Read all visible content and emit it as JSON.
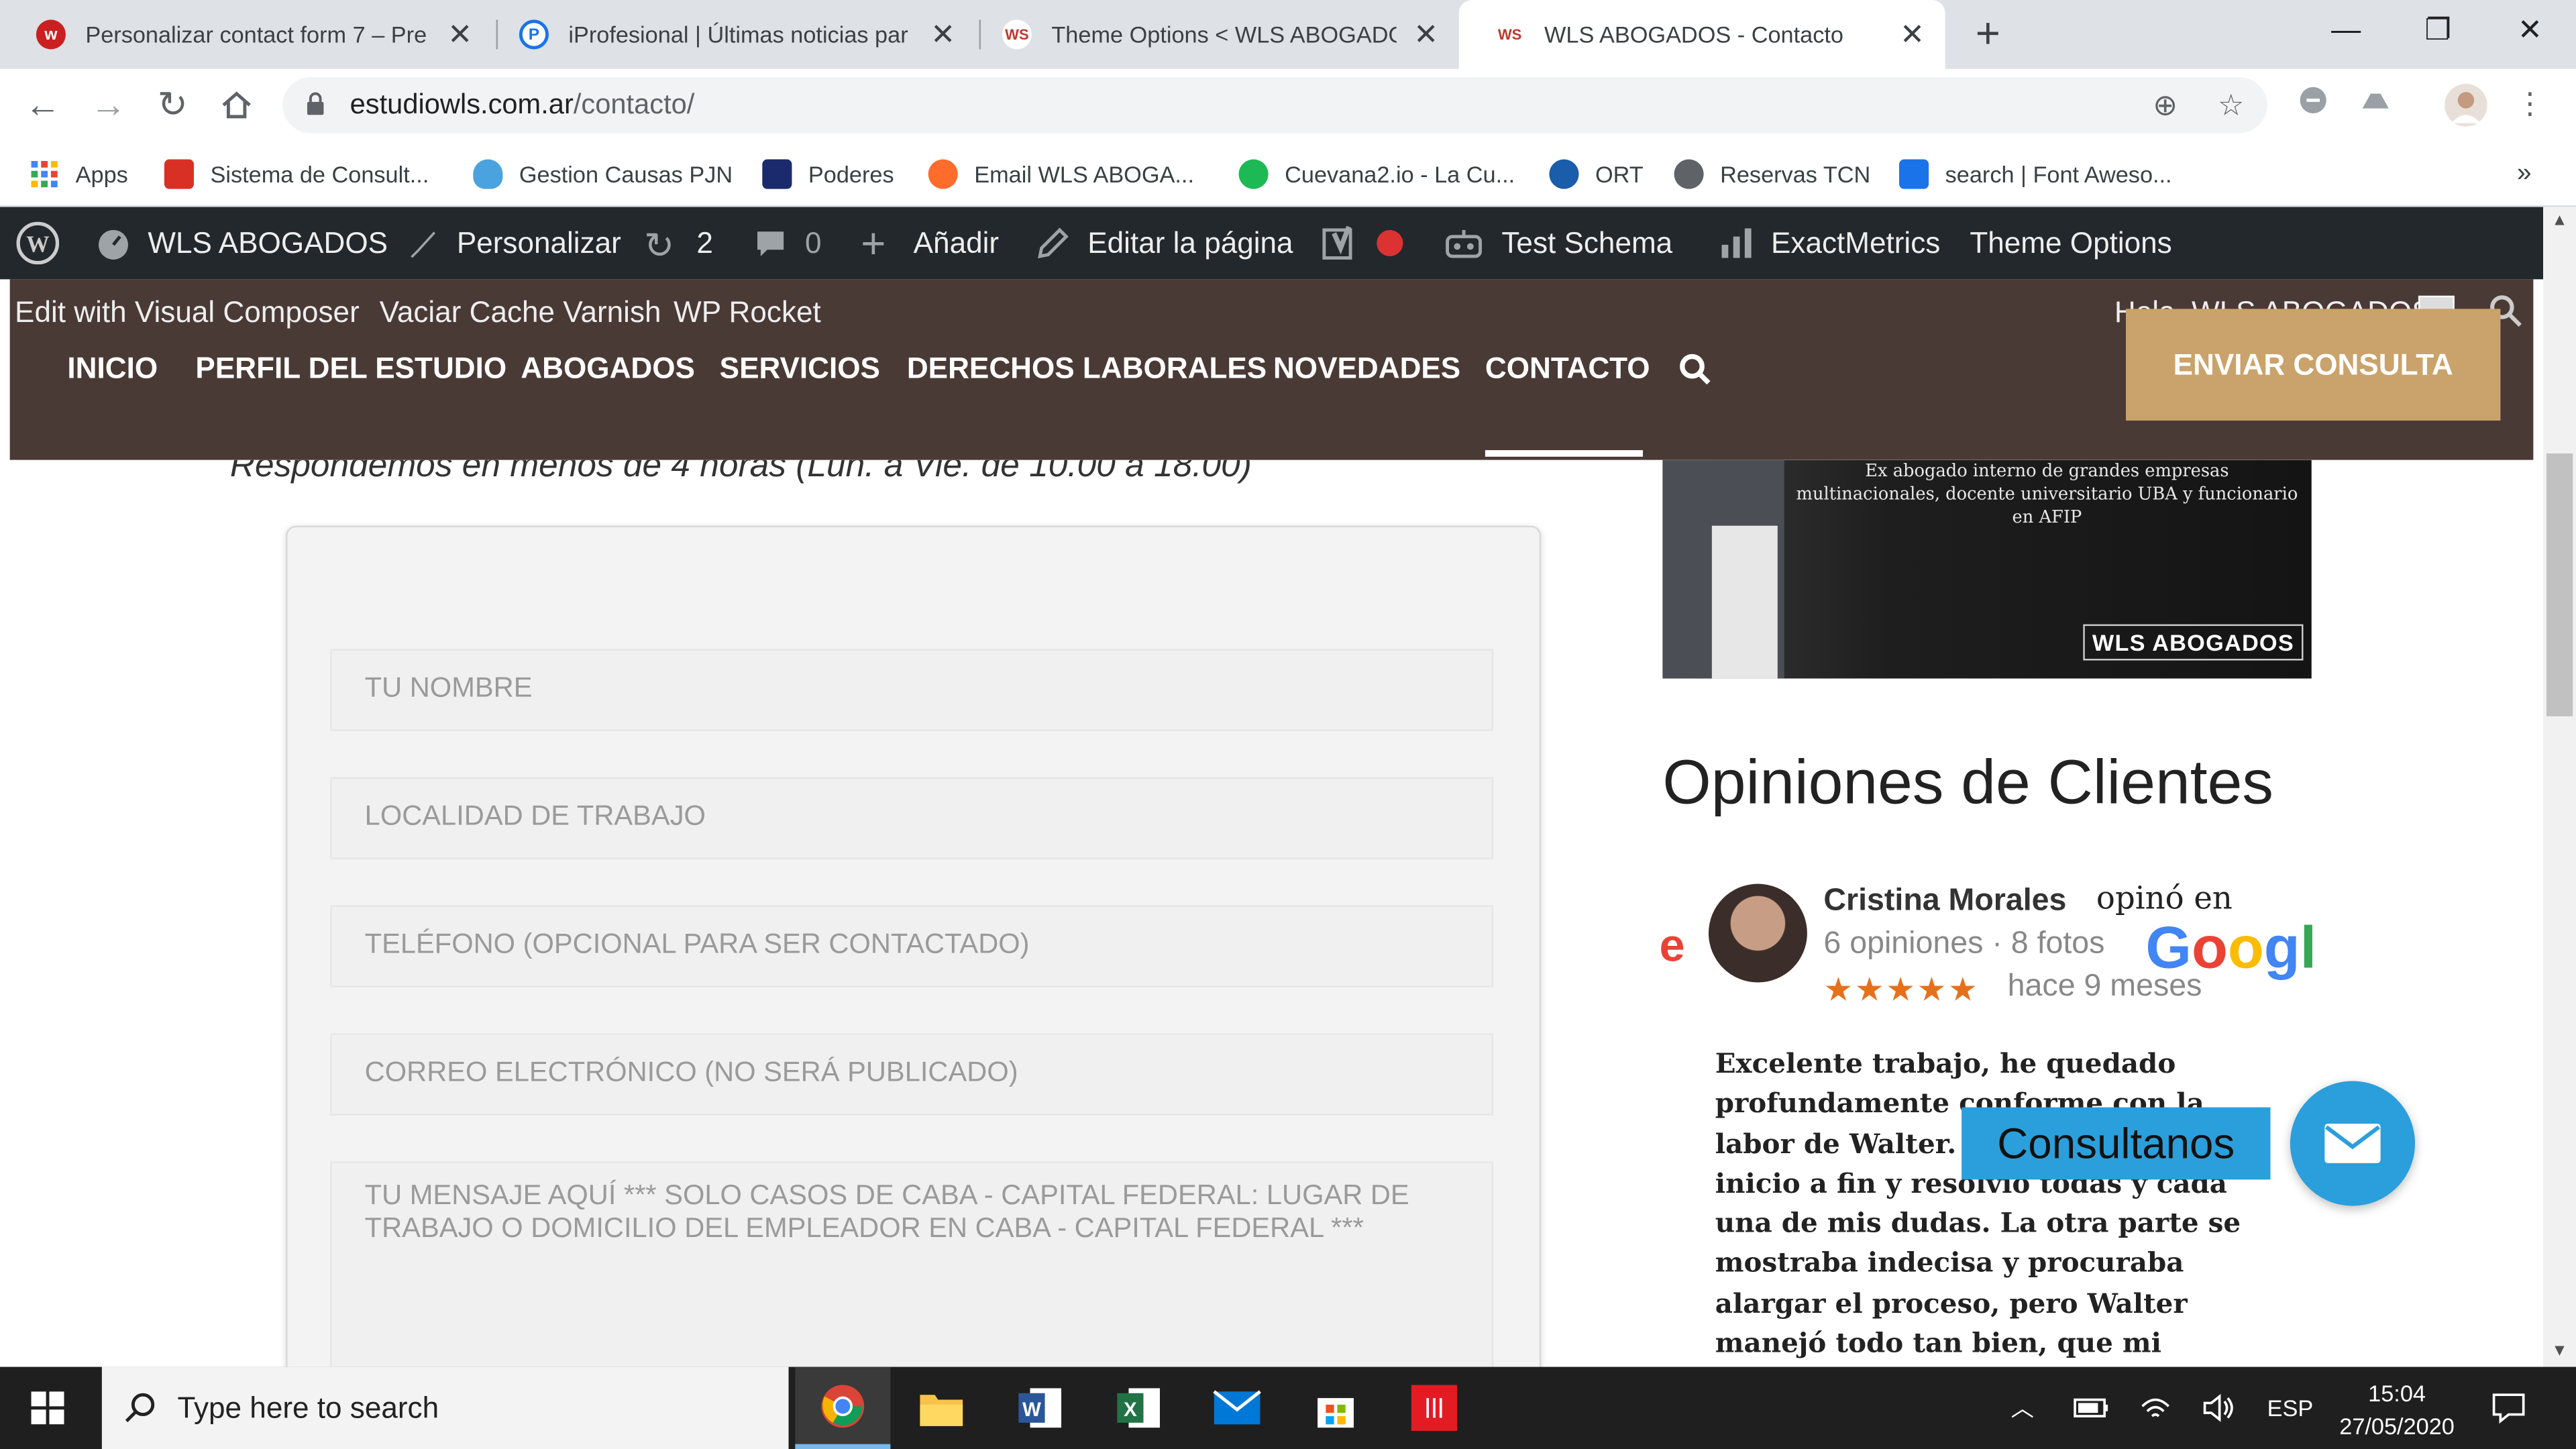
{
  "browser": {
    "tabs": [
      {
        "title": "Personalizar contact form 7 – Pre",
        "favicon_color": "#cc1f1f",
        "favicon_letter": "w"
      },
      {
        "title": "iProfesional | Últimas noticias par",
        "favicon_color": "#1a73e8",
        "favicon_letter": "P"
      },
      {
        "title": "Theme Options < WLS ABOGADO",
        "favicon_color": "#c0392b",
        "favicon_letter": "WS"
      },
      {
        "title": "WLS ABOGADOS - Contacto",
        "favicon_color": "#c0392b",
        "favicon_letter": "WS"
      }
    ],
    "active_tab": 3,
    "url_host": "estudiowls.com.ar",
    "url_path": "/contacto/",
    "bookmarks": [
      {
        "label": "Apps",
        "icon": "apps-grid-icon",
        "color": "#4285f4"
      },
      {
        "label": "Sistema de Consult...",
        "icon": "magnifier-doc-icon",
        "color": "#d93025"
      },
      {
        "label": "Gestion Causas PJN",
        "icon": "coat-of-arms-icon",
        "color": "#4aa3df"
      },
      {
        "label": "Poderes",
        "icon": "pjn-icon",
        "color": "#1a2a6c"
      },
      {
        "label": "Email WLS ABOGA...",
        "icon": "cpanel-icon",
        "color": "#ff6c2c"
      },
      {
        "label": "Cuevana2.io - La Cu...",
        "icon": "play-icon",
        "color": "#1db954"
      },
      {
        "label": "ORT",
        "icon": "ort-icon",
        "color": "#1a5dab"
      },
      {
        "label": "Reservas TCN",
        "icon": "globe-icon",
        "color": "#5f6368"
      },
      {
        "label": "search | Font Aweso...",
        "icon": "flag-icon",
        "color": "#1a73e8"
      }
    ]
  },
  "wp_admin": {
    "site_name": "WLS ABOGADOS",
    "customize": "Personalizar",
    "updates_count": "2",
    "comments_count": "0",
    "add_new": "Añadir",
    "edit_page": "Editar la página",
    "test_schema": "Test Schema",
    "exactmetrics": "ExactMetrics",
    "theme_options": "Theme Options",
    "visual_composer": "Edit with Visual Composer",
    "varnish": "Vaciar Cache Varnish",
    "wp_rocket": "WP Rocket",
    "greeting": "Hola, WLS ABOGADOS"
  },
  "site_nav": {
    "items": [
      "INICIO",
      "PERFIL DEL ESTUDIO",
      "ABOGADOS",
      "SERVICIOS",
      "DERECHOS LABORALES",
      "NOVEDADES",
      "CONTACTO"
    ],
    "active": "CONTACTO",
    "cta": "ENVIAR CONSULTA"
  },
  "contact": {
    "subtitle": "Respondemos en menos de 4 horas (Lun. a Vie. de 10.00 a 18.00)",
    "fields": {
      "name": "TU NOMBRE",
      "locality": "LOCALIDAD DE TRABAJO",
      "phone": "TELÉFONO (OPCIONAL PARA SER CONTACTADO)",
      "email": "CORREO ELECTRÓNICO (NO SERÁ PUBLICADO)",
      "message": "TU MENSAJE AQUÍ *** SOLO CASOS DE CABA - CAPITAL FEDERAL: LUGAR DE TRABAJO O DOMICILIO DEL EMPLEADOR EN CABA - CAPITAL FEDERAL ***"
    }
  },
  "sidebar": {
    "photo_caption": "Ex abogado interno de grandes empresas multinacionales, docente universitario UBA y funcionario en AFIP",
    "photo_logo": "WLS ABOGADOS",
    "reviews_title": "Opiniones de Clientes",
    "review": {
      "name": "Cristina Morales",
      "opined": "opinó en",
      "meta": "6 opiniones · 8 fotos",
      "brand": "Google",
      "stars": "★★★★★",
      "rating": 5,
      "when": "hace 9 meses",
      "text": "Excelente trabajo, he quedado profundamente conforme con la labor de Walter. Me asesoró de inicio a fin y resolvió todas y cada una de mis dudas. La otra parte se mostraba indecisa y procuraba alargar el proceso, pero Walter manejó todo tan bien, que mi"
    }
  },
  "widget": {
    "consult_label": "Consultanos"
  },
  "taskbar": {
    "search_placeholder": "Type here to search",
    "language": "ESP",
    "time": "15:04",
    "date": "27/05/2020"
  }
}
